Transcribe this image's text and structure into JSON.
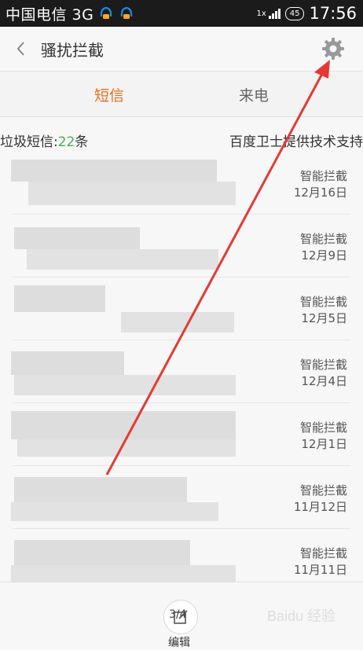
{
  "status_bar": {
    "carrier": "中国电信 3G",
    "network": "1x",
    "battery": "45",
    "time": "17:56"
  },
  "header": {
    "title": "骚扰拦截",
    "back_icon": "chevron-left-icon",
    "settings_icon": "gear-icon"
  },
  "tabs": [
    {
      "label": "短信",
      "active": true
    },
    {
      "label": "来电",
      "active": false
    }
  ],
  "info": {
    "prefix": "垃圾短信:",
    "count": "22",
    "suffix": "条",
    "provider": "百度卫士提供技术支持"
  },
  "messages": [
    {
      "tag": "智能拦截",
      "date": "12月16日"
    },
    {
      "tag": "智能拦截",
      "date": "12月9日"
    },
    {
      "tag": "智能拦截",
      "date": "12月5日"
    },
    {
      "tag": "智能拦截",
      "date": "12月4日"
    },
    {
      "tag": "智能拦截",
      "date": "12月1日"
    },
    {
      "tag": "智能拦截",
      "date": "11月12日"
    },
    {
      "tag": "智能拦截",
      "date": "11月11日"
    }
  ],
  "bottom_bar": {
    "edit_label": "编辑",
    "edit_badge": "3/4"
  },
  "colors": {
    "accent": "#ea6e1c",
    "count": "#4caf50",
    "arrow": "#e53935"
  }
}
